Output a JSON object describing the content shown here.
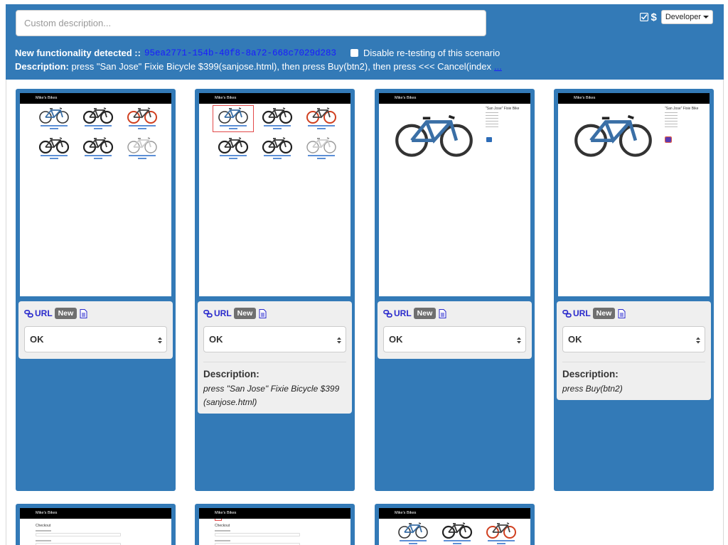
{
  "header": {
    "description_placeholder": "Custom description...",
    "env_select": "Developer",
    "new_functionality_label": "New functionality detected ::",
    "functionality_id": "95ea2771-154b-40f8-8a72-668c7029d283",
    "disable_retest_label": "Disable re-testing of this scenario",
    "description_label": "Description:",
    "description_text": "press \"San Jose\" Fixie Bicycle $399(sanjose.html), then press Buy(btn2), then press <<< Cancel(index",
    "more_link": "..."
  },
  "shop_title": "Mike's Bikes",
  "product_title": "\"San Jose\" Fixie Bike",
  "checkout_title": "Checkout",
  "steps": [
    {
      "url_label": "URL",
      "badge": "New",
      "status": "OK",
      "desc_label": "",
      "desc_text": ""
    },
    {
      "url_label": "URL",
      "badge": "New",
      "status": "OK",
      "desc_label": "Description:",
      "desc_text": "press \"San Jose\" Fixie Bicycle $399(sanjose.html)"
    },
    {
      "url_label": "URL",
      "badge": "New",
      "status": "OK",
      "desc_label": "",
      "desc_text": ""
    },
    {
      "url_label": "URL",
      "badge": "New",
      "status": "OK",
      "desc_label": "Description:",
      "desc_text": "press Buy(btn2)"
    }
  ],
  "colors": {
    "primary": "#337ab7",
    "link": "#2a2acc",
    "id_link": "#1a1aff",
    "badge": "#6f6f6f",
    "selection": "#e24a4a"
  }
}
